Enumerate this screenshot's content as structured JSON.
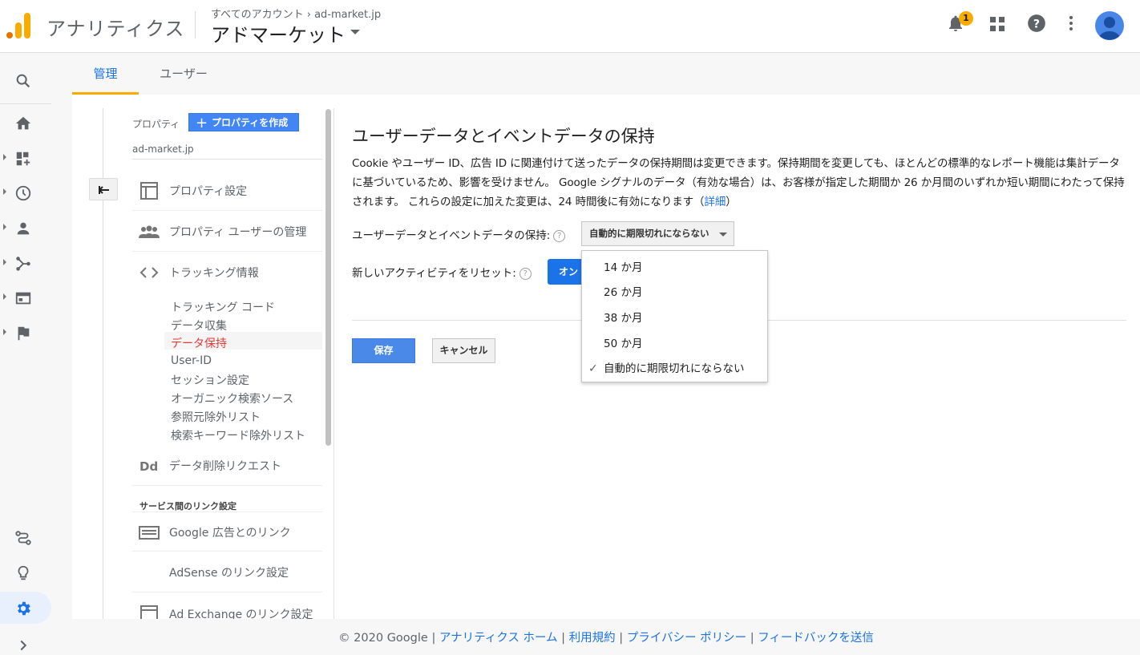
{
  "header": {
    "app_name": "アナリティクス",
    "breadcrumb_all": "すべてのアカウント",
    "breadcrumb_sep": "›",
    "breadcrumb_account": "ad-market.jp",
    "account_title": "アドマーケット",
    "notification_count": "1"
  },
  "tabs": [
    {
      "label": "管理",
      "active": true
    },
    {
      "label": "ユーザー",
      "active": false
    }
  ],
  "property_panel": {
    "label": "プロパティ",
    "create_button": "プロパティを作成",
    "property_name": "ad-market.jp",
    "nav_items": [
      {
        "label": "プロパティ設定",
        "icon": "layout-icon"
      },
      {
        "label": "プロパティ ユーザーの管理",
        "icon": "people-icon"
      },
      {
        "label": "トラッキング情報",
        "icon": "code-icon"
      }
    ],
    "tracking_sub_items": [
      "トラッキング コード",
      "データ収集",
      "データ保持",
      "User-ID",
      "セッション設定",
      "オーガニック検索ソース",
      "参照元除外リスト",
      "検索キーワード除外リスト"
    ],
    "active_sub_item": "データ保持",
    "data_deletion": "データ削除リクエスト",
    "link_section": "サービス間のリンク設定",
    "link_items": [
      "Google 広告とのリンク",
      "AdSense のリンク設定",
      "Ad Exchange のリンク設定"
    ]
  },
  "main": {
    "title": "ユーザーデータとイベントデータの保持",
    "description": "Cookie やユーザー ID、広告 ID に関連付けて送ったデータの保持期間は変更できます。保持期間を変更しても、ほとんどの標準的なレポート機能は集計データに基づいているため、影響を受けません。 Google シグナルのデータ（有効な場合）は、お客様が指定した期間か 26 か月間のいずれか短い期間にわたって保持されます。 これらの設定に加えた変更は、24 時間後に有効になります（",
    "description_link": "詳細",
    "description_end": "）",
    "retention_label": "ユーザーデータとイベントデータの保持:",
    "retention_value": "自動的に期限切れにならない",
    "reset_label": "新しいアクティビティをリセット:",
    "reset_toggle": "オン",
    "save": "保存",
    "cancel": "キャンセル"
  },
  "dropdown_options": [
    {
      "label": "14 か月",
      "selected": false
    },
    {
      "label": "26 か月",
      "selected": false
    },
    {
      "label": "38 か月",
      "selected": false
    },
    {
      "label": "50 か月",
      "selected": false
    },
    {
      "label": "自動的に期限切れにならない",
      "selected": true
    }
  ],
  "footer": {
    "copyright": "© 2020 Google",
    "sep": " | ",
    "links": [
      "アナリティクス ホーム",
      "利用規約",
      "プライバシー ポリシー",
      "フィードバックを送信"
    ]
  },
  "colors": {
    "accent": "#1a73e8",
    "brand_orange": "#f9ab00",
    "active_nav": "#e53935"
  }
}
